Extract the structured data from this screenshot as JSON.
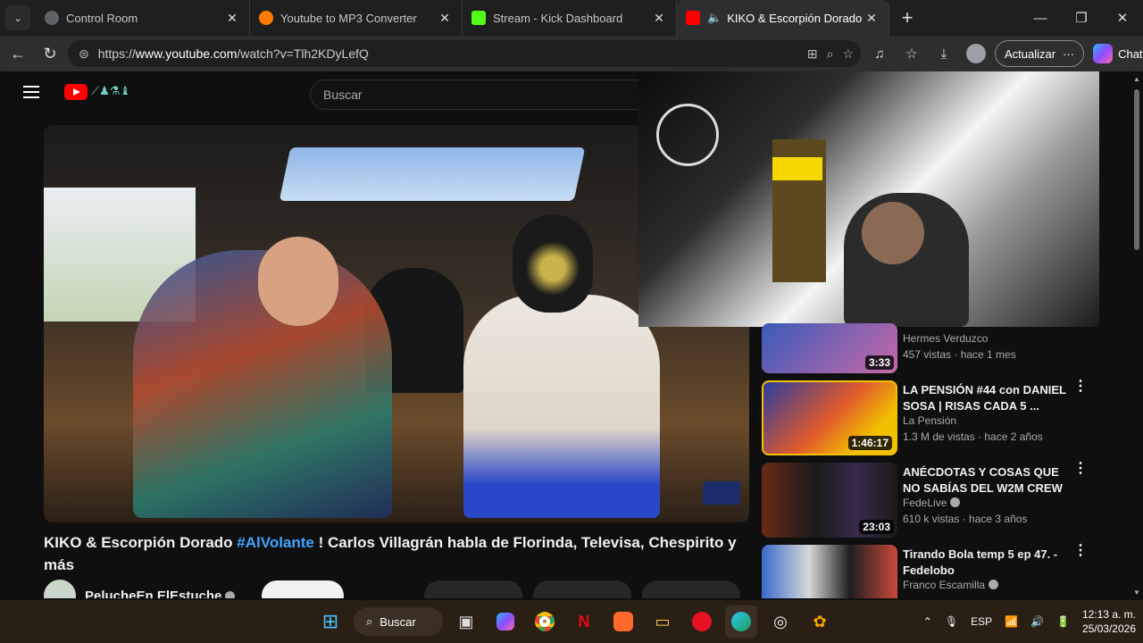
{
  "browser": {
    "tabs": [
      {
        "label": "Control Room",
        "favicon_color": "#5f6368"
      },
      {
        "label": "Youtube to MP3 Converter",
        "favicon_color": "#ff7a00"
      },
      {
        "label": "Stream - Kick Dashboard",
        "favicon_color": "#53fc18"
      },
      {
        "label": "KIKO & Escorpión Dorado #Al",
        "favicon_color": "#ff0000"
      }
    ],
    "url_prefix": "https://",
    "url_host": "www.youtube.com",
    "url_path": "/watch?v=Tlh2KDyLefQ",
    "update_label": "Actualizar",
    "chat_label": "Chat"
  },
  "youtube": {
    "search_placeholder": "Buscar",
    "video_title": "KIKO & Escorpión Dorado ",
    "video_title_hashtag": "#AlVolante",
    "video_title_rest": " ! Carlos Villagrán habla de Florinda, Televisa, Chespirito y más",
    "channel_name": "PelucheEn ElEstuche"
  },
  "recommendations": [
    {
      "title": "",
      "channel": "Hermes Verduzco",
      "meta": "457 vistas · hace 1 mes",
      "duration": "3:33",
      "verified": false
    },
    {
      "title": "LA PENSIÓN #44 con DANIEL SOSA | RISAS CADA 5 ...",
      "channel": "La Pensión",
      "meta": "1.3 M de vistas · hace 2 años",
      "duration": "1:46:17",
      "verified": false
    },
    {
      "title": "ANÉCDOTAS Y COSAS QUE NO SABÍAS DEL W2M CREW",
      "channel": "FedeLive",
      "meta": "610 k vistas · hace 3 años",
      "duration": "23:03",
      "verified": true
    },
    {
      "title": "Tirando Bola temp 5 ep 47. - Fedelobo",
      "channel": "Franco Escamilla",
      "meta": "",
      "duration": "",
      "verified": true
    }
  ],
  "taskbar": {
    "search_label": "Buscar",
    "language": "ESP",
    "time": "12:13 a. m.",
    "date": "25/03/2026"
  }
}
